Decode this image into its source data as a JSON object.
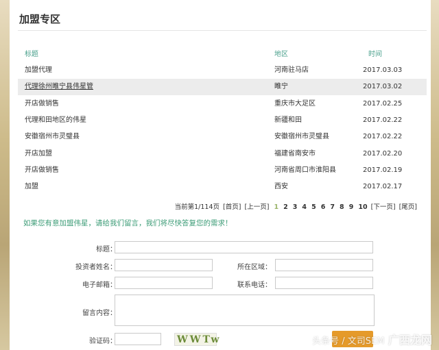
{
  "section_title": "加盟专区",
  "table": {
    "headers": {
      "title": "标题",
      "region": "地区",
      "time": "时间"
    },
    "rows": [
      {
        "title": "加盟代理",
        "region": "河南驻马店",
        "time": "2017.03.03"
      },
      {
        "title": "代理徐州睢宁县伟星管",
        "region": "睢宁",
        "time": "2017.03.02"
      },
      {
        "title": "开店做销售",
        "region": "重庆市大足区",
        "time": "2017.02.25"
      },
      {
        "title": "代理和田地区的伟星",
        "region": "新疆和田",
        "time": "2017.02.22"
      },
      {
        "title": "安徽宿州市灵璧县",
        "region": "安徽宿州市灵璧县",
        "time": "2017.02.22"
      },
      {
        "title": "开店加盟",
        "region": "福建省南安市",
        "time": "2017.02.20"
      },
      {
        "title": "开店做销售",
        "region": "河南省周口市淮阳县",
        "time": "2017.02.19"
      },
      {
        "title": "加盟",
        "region": "西安",
        "time": "2017.02.17"
      }
    ]
  },
  "pager": {
    "status": "当前第1/114页",
    "first": "[首页]",
    "prev": "[上一页]",
    "pages": [
      "1",
      "2",
      "3",
      "4",
      "5",
      "6",
      "7",
      "8",
      "9",
      "10"
    ],
    "next": "[下一页]",
    "last": "[尾页]"
  },
  "notice": "如果您有意加盟伟星，请给我们留言，我们将尽快答复您的需求！",
  "form": {
    "title_label": "标题：",
    "name_label": "投资者姓名：",
    "area_label": "所在区域：",
    "email_label": "电子邮箱：",
    "phone_label": "联系电话：",
    "message_label": "留言内容：",
    "captcha_label": "验证码：",
    "captcha_text": "WWTw"
  },
  "watermark": {
    "left": "头条号",
    "middle": " / 文司SEM",
    "brand": "广西龙网"
  }
}
